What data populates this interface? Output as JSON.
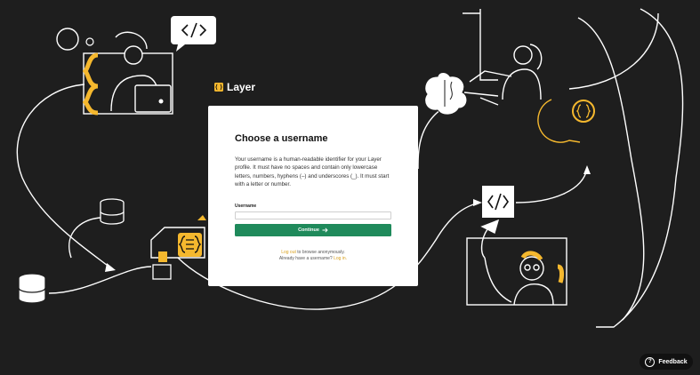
{
  "brand": {
    "name": "Layer"
  },
  "card": {
    "title": "Choose a username",
    "description": "Your username is a human-readable identifier for your Layer profile. It must have no spaces and contain only lowercase letters, numbers, hyphens (–) and underscores (_). It must start with a letter or number.",
    "username_label": "Username",
    "username_value": "",
    "continue_label": "Continue",
    "logout_link": "Log out",
    "logout_suffix": " to browse anonymously.",
    "login_prefix": "Already have a username? ",
    "login_link": "Log in."
  },
  "feedback": {
    "label": "Feedback"
  },
  "icons": {
    "code": "code-icon",
    "brackets": "curly-brackets-icon",
    "database": "database-icon",
    "brain": "brain-icon",
    "arrow": "arrow-right-icon",
    "help": "question-icon"
  },
  "colors": {
    "background": "#1e1e1e",
    "accent": "#f5b82e",
    "button": "#1f8a5b",
    "link": "#d9a11f"
  }
}
